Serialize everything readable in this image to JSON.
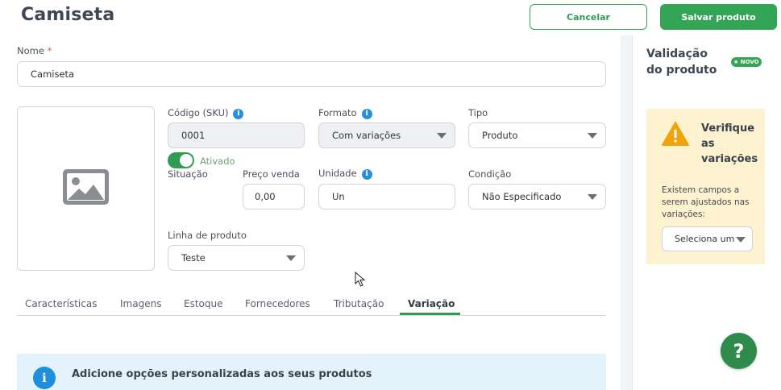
{
  "header": {
    "title": "Camiseta",
    "cancel_label": "Cancelar",
    "save_label": "Salvar produto"
  },
  "form": {
    "nome": {
      "label": "Nome",
      "required_mark": "*",
      "value": "Camiseta"
    },
    "image_placeholder_icon": "image-icon",
    "codigo": {
      "label": "Código (SKU)",
      "value": "0001"
    },
    "formato": {
      "label": "Formato",
      "value": "Com variações"
    },
    "tipo": {
      "label": "Tipo",
      "value": "Produto"
    },
    "situacao": {
      "label": "Situação",
      "value": "Ativado",
      "enabled": true
    },
    "preco": {
      "label": "Preço venda",
      "value": "0,00"
    },
    "unidade": {
      "label": "Unidade",
      "value": "Un"
    },
    "condicao": {
      "label": "Condição",
      "value": "Não Especificado"
    },
    "linha": {
      "label": "Linha de produto",
      "value": "Teste"
    },
    "info_icon_glyph": "i"
  },
  "tabs": [
    {
      "label": "Características"
    },
    {
      "label": "Imagens"
    },
    {
      "label": "Estoque"
    },
    {
      "label": "Fornecedores"
    },
    {
      "label": "Tributação"
    },
    {
      "label": "Variação",
      "active": true
    }
  ],
  "banner": {
    "icon_glyph": "i",
    "text": "Adicione opções personalizadas aos seus produtos"
  },
  "validation": {
    "title_line1": "Validação",
    "title_line2": "do produto",
    "badge": "★ NOVO",
    "warning_title_line1": "Verifique",
    "warning_title_line2": "as",
    "warning_title_line3": "variações",
    "warning_text": "Existem campos a serem ajustados nas variações:",
    "select_value": "Seleciona um",
    "help_label": "?"
  },
  "colors": {
    "brand_green": "#34a456",
    "info_blue": "#1d8fdc",
    "warning_bg": "#fdf2cf",
    "warning_icon": "#f0a30a"
  }
}
